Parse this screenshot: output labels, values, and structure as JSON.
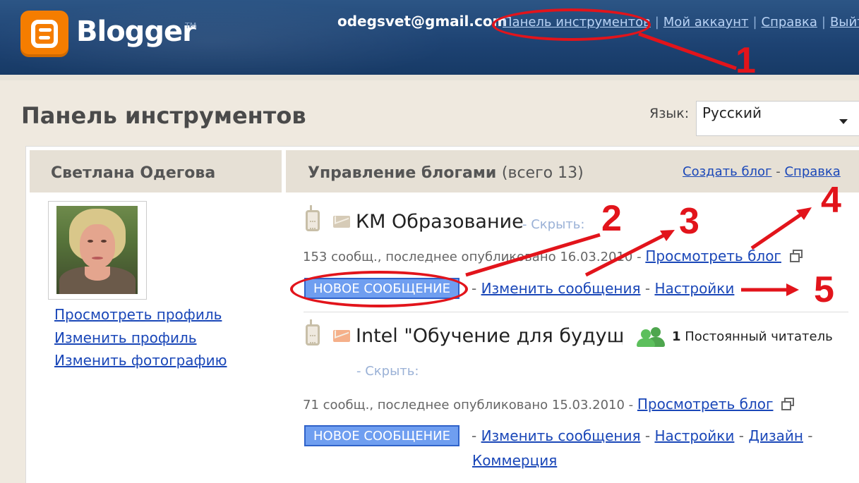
{
  "header": {
    "logo_text": "Blogger",
    "logo_tm": "TM",
    "email": "odegsvet@gmail.com",
    "nav": [
      "Панель инструментов",
      "Мой аккаунт",
      "Справка",
      "Выйти"
    ]
  },
  "page": {
    "title": "Панель инструментов",
    "language_label": "Язык:",
    "language_value": "Русский"
  },
  "profile": {
    "name": "Светлана Одегова",
    "links": [
      "Просмотреть профиль",
      "Изменить профиль",
      "Изменить фотографию"
    ]
  },
  "blogs": {
    "title": "Управление блогами",
    "count": "(всего 13)",
    "create_link": "Создать блог",
    "help_link": "Справка",
    "items": [
      {
        "name": "КМ Образование",
        "hide": "Скрыть:",
        "meta": "153 сообщ., последнее опубликовано 16.03.2010 -",
        "view": "Просмотреть блог",
        "new_post": "НОВОЕ СООБЩЕНИЕ",
        "edit_posts": "Изменить сообщения",
        "settings": "Настройки"
      },
      {
        "name": "Intel \"Обучение для будуще",
        "followers_count": "1",
        "followers_text": "Постоянный читатель",
        "hide": "Скрыть:",
        "meta": "71 сообщ., последнее опубликовано 15.03.2010 -",
        "view": "Просмотреть блог",
        "new_post": "НОВОЕ СООБЩЕНИЕ",
        "edit_posts": "Изменить сообщения",
        "settings": "Настройки",
        "design": "Дизайн",
        "commerce": "Коммерция"
      }
    ]
  },
  "annotations": [
    "1",
    "2",
    "3",
    "4",
    "5"
  ],
  "colors": {
    "annotation": "#e2141b",
    "header": "#1d4272",
    "button": "#6f9ef0",
    "link": "#1a47b8"
  }
}
